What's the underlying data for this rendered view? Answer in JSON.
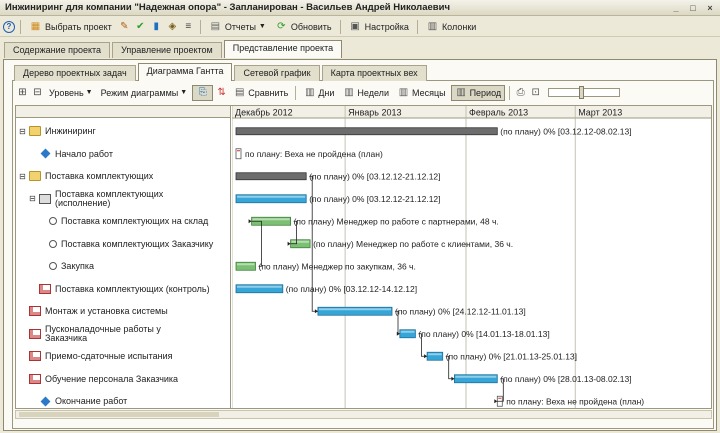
{
  "window": {
    "title": "Инжиниринг для компании \"Надежная опора\" - Запланирован - Васильев Андрей Николаевич",
    "buttons": [
      "_",
      "□",
      "×"
    ]
  },
  "toolbar": {
    "select_project": "Выбрать проект",
    "reports": "Отчеты",
    "refresh": "Обновить",
    "settings": "Настройка",
    "columns": "Колонки"
  },
  "tabs1": [
    "Содержание проекта",
    "Управление проектом",
    "Представление проекта"
  ],
  "tabs2": [
    "Дерево проектных задач",
    "Диаграмма Гантта",
    "Сетевой график",
    "Карта проектных вех"
  ],
  "gantt_toolbar": {
    "level": "Уровень",
    "diagram_mode": "Режим диаграммы",
    "compare": "Сравнить",
    "days": "Дни",
    "weeks": "Недели",
    "months": "Месяцы",
    "period": "Период"
  },
  "timeline": {
    "months": [
      "Декабрь 2012",
      "Январь 2013",
      "Февраль 2013",
      "Март 2013"
    ]
  },
  "tasks": [
    {
      "name": "Инжиниринг",
      "icon": "folder-icon",
      "tree": "minus",
      "indent": 0,
      "bar": "summary",
      "start": 0,
      "end": 67,
      "label": "(по плану) 0% [03.12.12-08.02.13]"
    },
    {
      "name": "Начало работ",
      "icon": "milestone-icon",
      "tree": "",
      "indent": 1,
      "bar": "milestone",
      "start": 0,
      "end": 0,
      "label": "по плану: Веха не пройдена (план)"
    },
    {
      "name": "Поставка комплектующих",
      "icon": "folder-icon",
      "tree": "minus",
      "indent": 0,
      "bar": "summary",
      "start": 0,
      "end": 18,
      "label": "(по плану) 0% [03.12.12-21.12.12]"
    },
    {
      "name": "Поставка комплектующих (исполнение)",
      "icon": "task-group-icon",
      "tree": "minus",
      "indent": 1,
      "bar": "blue",
      "start": 0,
      "end": 18,
      "label": "(по плану) 0% [03.12.12-21.12.12]"
    },
    {
      "name": "Поставка комплектующих на склад",
      "icon": "subtask-icon",
      "tree": "",
      "indent": 2,
      "bar": "green",
      "start": 4,
      "end": 14,
      "label": "(по плану) Менеджер по работе с партнерами, 48 ч."
    },
    {
      "name": "Поставка комплектующих Заказчику",
      "icon": "subtask-icon",
      "tree": "",
      "indent": 2,
      "bar": "green",
      "start": 14,
      "end": 19,
      "label": "(по плану) Менеджер по работе с клиентами, 36 ч."
    },
    {
      "name": "Закупка",
      "icon": "subtask-icon",
      "tree": "",
      "indent": 2,
      "bar": "green",
      "start": 0,
      "end": 5,
      "label": "(по плану) Менеджер по закупкам, 36 ч."
    },
    {
      "name": "Поставка комплектующих (контроль)",
      "icon": "task-icon",
      "tree": "",
      "indent": 1,
      "bar": "blue",
      "start": 0,
      "end": 12,
      "label": "(по плану) 0% [03.12.12-14.12.12]"
    },
    {
      "name": "Монтаж и установка системы",
      "icon": "task-icon",
      "tree": "",
      "indent": 0,
      "bar": "blue",
      "start": 21,
      "end": 40,
      "label": "(по плану) 0% [24.12.12-11.01.13]"
    },
    {
      "name": "Пусконаладочные работы у Заказчика",
      "icon": "task-icon",
      "tree": "",
      "indent": 0,
      "bar": "blue",
      "start": 42,
      "end": 46,
      "label": "(по плану) 0% [14.01.13-18.01.13]"
    },
    {
      "name": "Приемо-сдаточные испытания",
      "icon": "task-icon",
      "tree": "",
      "indent": 0,
      "bar": "blue",
      "start": 49,
      "end": 53,
      "label": "(по плану) 0% [21.01.13-25.01.13]"
    },
    {
      "name": "Обучение персонала Заказчика",
      "icon": "task-icon",
      "tree": "",
      "indent": 0,
      "bar": "blue",
      "start": 56,
      "end": 67,
      "label": "(по плану) 0% [28.01.13-08.02.13]"
    },
    {
      "name": "Окончание работ",
      "icon": "milestone-icon",
      "tree": "",
      "indent": 1,
      "bar": "milestone",
      "start": 67,
      "end": 67,
      "label": "по плану: Веха не пройдена (план)"
    }
  ],
  "colors": {
    "blue_bar": "#36a6d8",
    "green_bar": "#7cc173",
    "summary_bar": "#6d6d6d",
    "link_line": "#222222"
  }
}
